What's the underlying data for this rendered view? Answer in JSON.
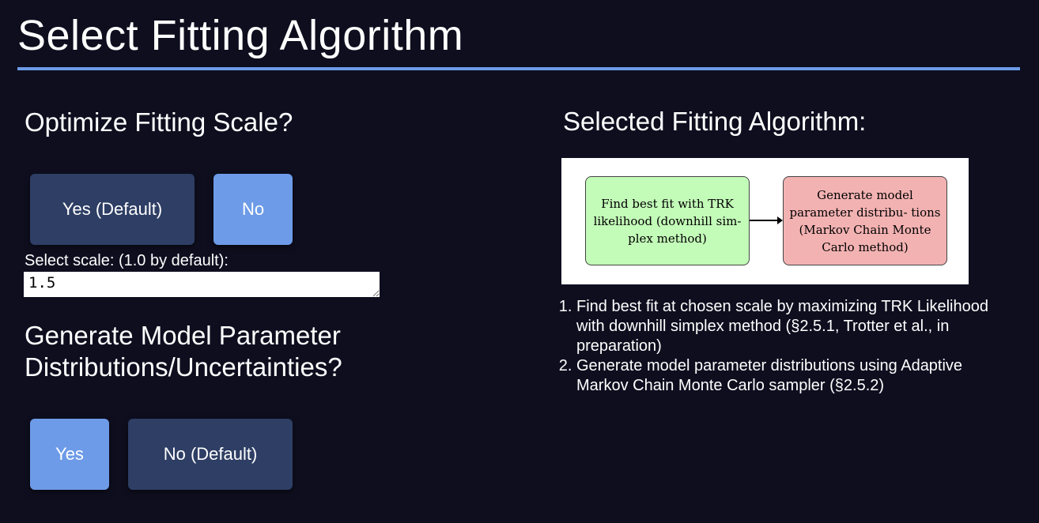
{
  "page_title": "Select Fitting Algorithm",
  "colors": {
    "background": "#0e0e1f",
    "accent": "#6d9be8",
    "button_unselected": "#2e3e64"
  },
  "scale_section": {
    "heading": "Optimize Fitting Scale?",
    "yes_label": "Yes (Default)",
    "no_label": "No",
    "selected": "No",
    "scale_label": "Select scale: (1.0 by default):",
    "scale_value": "1.5"
  },
  "mcmc_section": {
    "heading": "Generate Model Parameter Distributions/Uncertainties?",
    "yes_label": "Yes",
    "no_label": "No (Default)",
    "selected": "Yes"
  },
  "algorithm": {
    "heading": "Selected Fitting Algorithm:",
    "diagram": {
      "step1": "Find best fit with TRK likelihood (downhill sim- plex method)",
      "step2": "Generate model parameter distribu- tions (Markov Chain Monte Carlo method)"
    },
    "steps": [
      "Find best fit at chosen scale by maximizing TRK Likelihood with downhill simplex method (§2.5.1, Trotter et al., in preparation)",
      "Generate model parameter distributions using Adaptive Markov Chain Monte Carlo sampler (§2.5.2)"
    ]
  }
}
